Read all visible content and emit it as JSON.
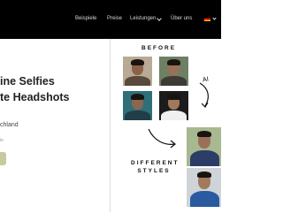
{
  "nav": {
    "items": [
      "Beispiele",
      "Preise",
      "Leistungen",
      "Über uns"
    ],
    "language_flag": "german-flag-icon"
  },
  "hero": {
    "line1": "ine Selfies",
    "line2": "te Headshots",
    "subline": "chland",
    "tiny_text": "le",
    "cta_color": "#c9c9a0"
  },
  "showcase": {
    "before_label": "BEFORE",
    "ai_label": "AI",
    "after_label_line1": "DIFFERENT",
    "after_label_line2": "STYLES"
  },
  "colors": {
    "navbar": "#000000",
    "cta": "#c9c9a0"
  }
}
